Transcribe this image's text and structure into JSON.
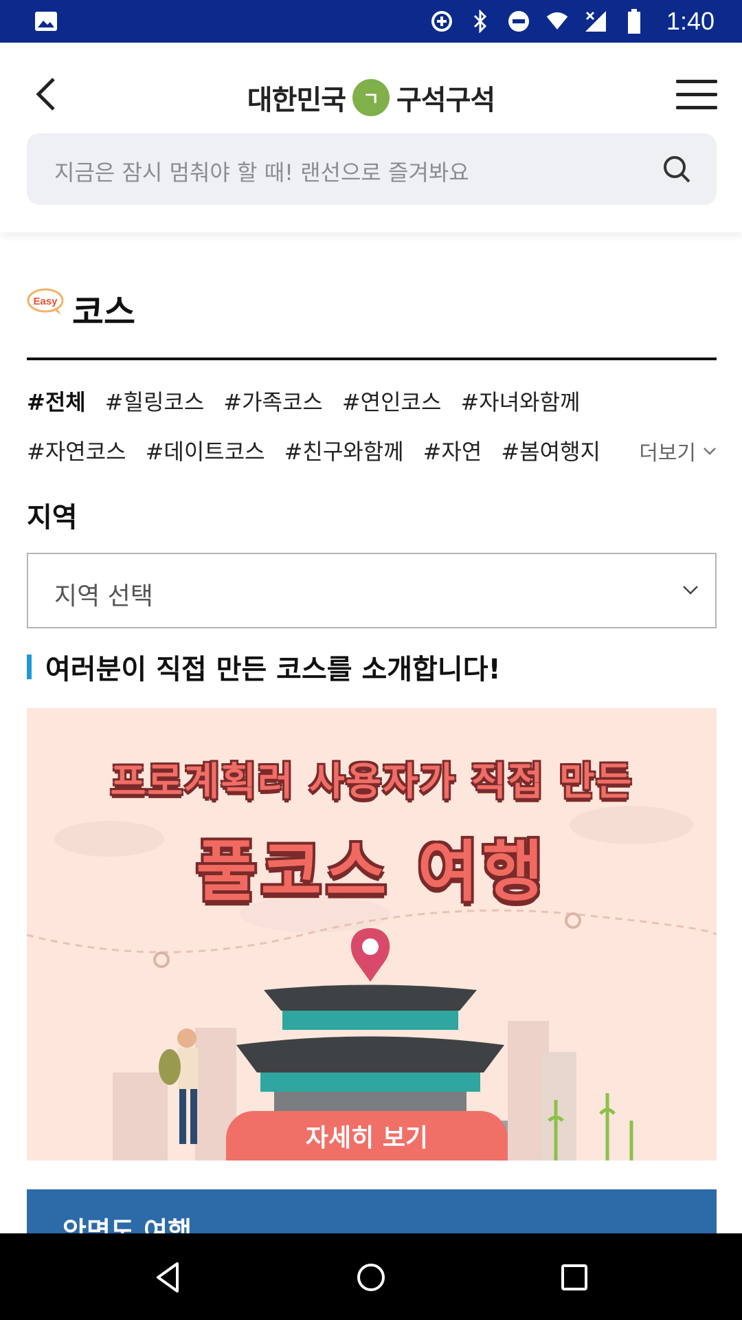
{
  "status_bar": {
    "time": "1:40"
  },
  "header": {
    "logo_left": "대한민국",
    "logo_mark": "ㄱ",
    "logo_right": "구석구석",
    "search_placeholder": "지금은 잠시 멈춰야 할 때! 랜선으로 즐겨봐요"
  },
  "page": {
    "badge": "Easy",
    "title": "코스",
    "tags_row1": [
      "#전체",
      "#힐링코스",
      "#가족코스",
      "#연인코스",
      "#자녀와함께"
    ],
    "tags_row2": [
      "#자연코스",
      "#데이트코스",
      "#친구와함께",
      "#자연",
      "#봄여행지"
    ],
    "more_label": "더보기",
    "region_label": "지역",
    "region_select": "지역 선택",
    "intro": "여러분이 직접 만든 코스를 소개합니다!"
  },
  "banner": {
    "line1": "프로계획러 사용자가 직접 만든",
    "line2": "풀코스 여행",
    "button": "자세히 보기"
  },
  "card": {
    "title": "안면도 여행"
  },
  "colors": {
    "status_bar": "#0b2a8c",
    "accent_bar": "#1e9bd7",
    "banner_bg": "#fde6dc",
    "banner_button": "#f07068",
    "card_bg": "#2d6aa8"
  }
}
